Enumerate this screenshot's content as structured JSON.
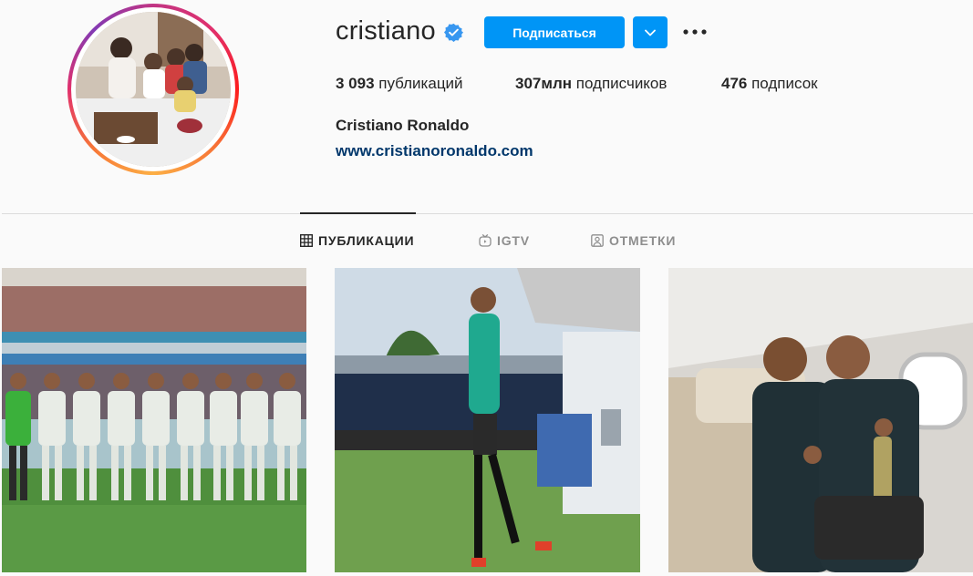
{
  "profile": {
    "username": "cristiano",
    "verified_icon": "verified-badge-icon",
    "follow_label": "Подписаться",
    "dropdown_icon": "chevron-down-icon",
    "more_icon": "more-horizontal-icon",
    "full_name": "Cristiano Ronaldo",
    "website": "www.cristianoronaldo.com"
  },
  "stats": {
    "posts_count": "3 093",
    "posts_label": " публикаций",
    "followers_count": "307млн",
    "followers_label": " подписчиков",
    "following_count": "476",
    "following_label": " подписок"
  },
  "tabs": [
    {
      "label": "ПУБЛИКАЦИИ",
      "icon": "grid-icon",
      "active": true
    },
    {
      "label": "IGTV",
      "icon": "igtv-icon",
      "active": false
    },
    {
      "label": "ОТМЕТКИ",
      "icon": "tagged-icon",
      "active": false
    }
  ],
  "posts": [
    {
      "description": "team-lineup-stadium"
    },
    {
      "description": "player-walking-stadium"
    },
    {
      "description": "two-players-airplane"
    }
  ],
  "colors": {
    "accent": "#0095f6",
    "link": "#00376b",
    "text": "#262626",
    "muted": "#8e8e8e"
  }
}
